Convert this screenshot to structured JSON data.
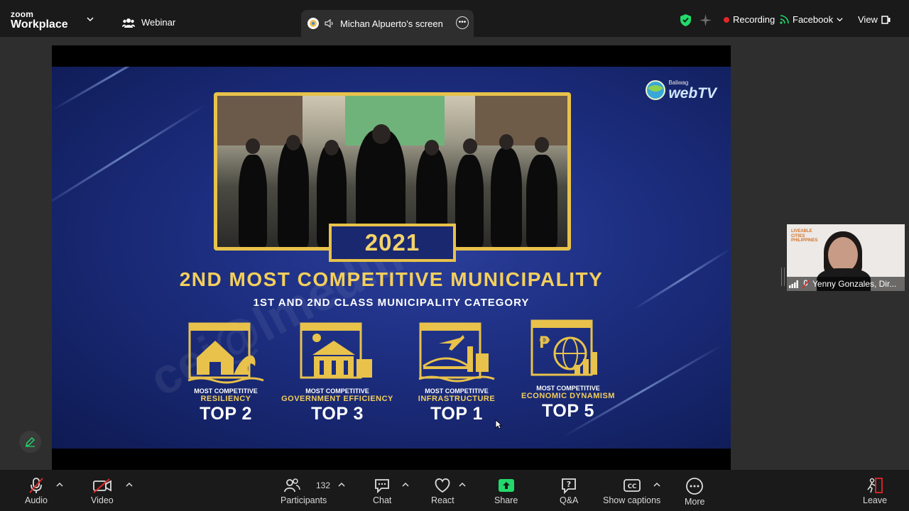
{
  "topbar": {
    "logo_line1": "zoom",
    "logo_line2": "Workplace",
    "webinar_label": "Webinar",
    "share_tab_label": "Michan Alpuerto's screen",
    "recording_label": "Recording",
    "facebook_label": "Facebook",
    "view_label": "View"
  },
  "slide": {
    "year": "2021",
    "headline": "2ND MOST COMPETITIVE MUNICIPALITY",
    "headline_ordinal": "ND",
    "subheadline": "1ST AND 2ND CLASS  MUNICIPALITY CATEGORY",
    "watermark": "cei@lmedities.ph",
    "broadcaster_small": "Baliwag",
    "broadcaster_big": "webTV",
    "categories": [
      {
        "line1": "MOST COMPETITIVE",
        "line2": "RESILIENCY",
        "rank": "TOP 2"
      },
      {
        "line1": "MOST COMPETITIVE",
        "line2": "GOVERNMENT EFFICIENCY",
        "rank": "TOP 3"
      },
      {
        "line1": "MOST COMPETITIVE",
        "line2": "INFRASTRUCTURE",
        "rank": "TOP 1"
      },
      {
        "line1": "MOST COMPETITIVE",
        "line2": "ECONOMIC DYNAMISM",
        "rank": "TOP 5"
      }
    ]
  },
  "pip": {
    "logo_text": "LIVEABLE CITIES PHILIPPINES",
    "name": "Yenny Gonzales, Dir..."
  },
  "toolbar": {
    "audio": "Audio",
    "video": "Video",
    "participants": "Participants",
    "participants_count": "132",
    "chat": "Chat",
    "react": "React",
    "share": "Share",
    "qa": "Q&A",
    "captions": "Show captions",
    "more": "More",
    "leave": "Leave"
  },
  "colors": {
    "accent_green": "#23d96b",
    "recording_red": "#e02828",
    "gold": "#f3cf5c",
    "slide_blue": "#1c2d7e"
  }
}
